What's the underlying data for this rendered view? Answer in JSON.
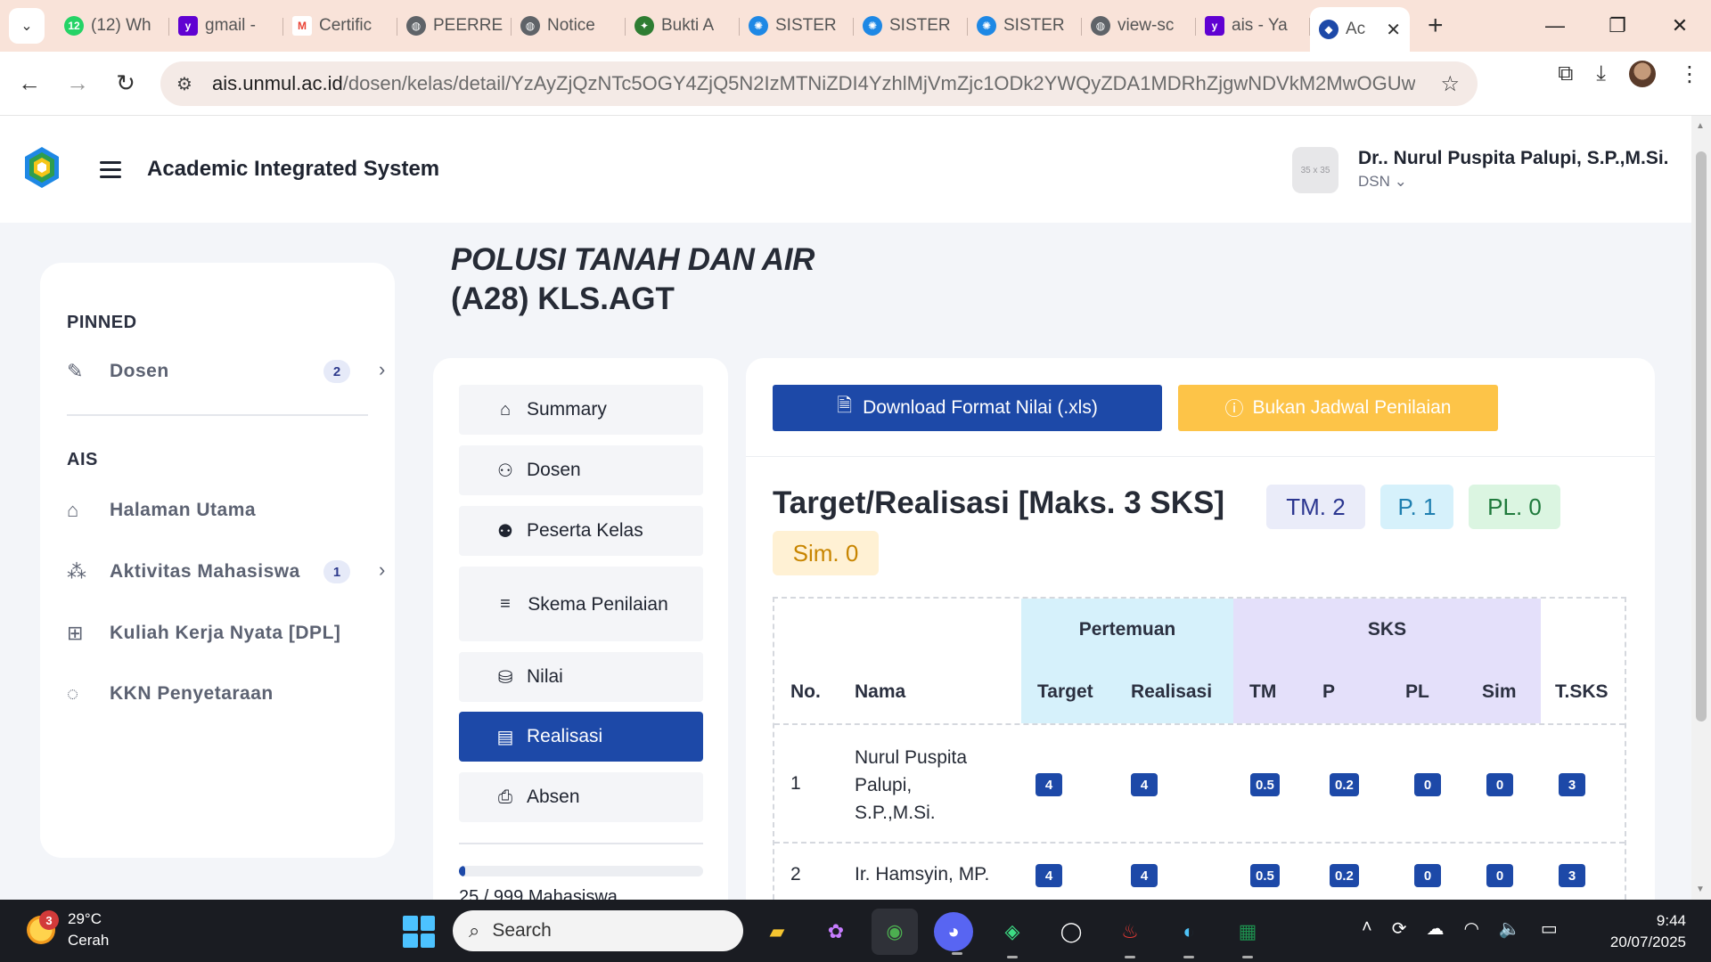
{
  "browser": {
    "tabs": [
      {
        "label": "(12) Wh",
        "icon": "whatsapp-icon",
        "color": "#25d366",
        "badge": "12"
      },
      {
        "label": "gmail -",
        "icon": "yahoo-icon",
        "color": "#6001d2"
      },
      {
        "label": "Certific",
        "icon": "gmail-icon",
        "color": "#ea4335"
      },
      {
        "label": "PEERRE",
        "icon": "globe-icon",
        "color": "#5f6368"
      },
      {
        "label": "Notice",
        "icon": "globe-icon",
        "color": "#5f6368"
      },
      {
        "label": "Bukti A",
        "icon": "unmul-icon",
        "color": "#2e7d32"
      },
      {
        "label": "SISTER",
        "icon": "sister-icon",
        "color": "#1e88e5"
      },
      {
        "label": "SISTER",
        "icon": "sister-icon",
        "color": "#1e88e5"
      },
      {
        "label": "SISTER",
        "icon": "sister-icon",
        "color": "#1e88e5"
      },
      {
        "label": "view-sc",
        "icon": "globe-icon",
        "color": "#5f6368"
      },
      {
        "label": "ais - Ya",
        "icon": "yahoo-icon",
        "color": "#6001d2"
      }
    ],
    "active_tab": {
      "label": "Ac",
      "icon": "ais-logo-icon"
    },
    "url_host": "ais.unmul.ac.id",
    "url_path": "/dosen/kelas/detail/YzAyZjQzNTc5OGY4ZjQ5N2IzMTNiZDI4YzhlMjVmZjc1ODk2YWQyZDA1MDRhZjgwNDVkM2MwOGUwMzEwO..."
  },
  "header": {
    "app_title": "Academic Integrated System",
    "avatar_placeholder": "35 x 35",
    "user_name": "Dr.. Nurul Puspita Palupi, S.P.,M.Si.",
    "user_role": "DSN"
  },
  "sidebar": {
    "pinned_title": "PINNED",
    "pinned_items": [
      {
        "label": "Dosen",
        "badge": "2"
      }
    ],
    "ais_title": "AIS",
    "ais_items": [
      {
        "label": "Halaman Utama"
      },
      {
        "label": "Aktivitas Mahasiswa",
        "badge": "1"
      },
      {
        "label": "Kuliah Kerja Nyata [DPL]"
      },
      {
        "label": "KKN Penyetaraan"
      }
    ]
  },
  "course": {
    "title": "POLUSI TANAH DAN AIR",
    "code": "(A28) KLS.AGT"
  },
  "class_menu": {
    "items": [
      {
        "label": "Summary",
        "icon": "home-icon"
      },
      {
        "label": "Dosen",
        "icon": "user-plus-icon"
      },
      {
        "label": "Peserta Kelas",
        "icon": "users-icon"
      },
      {
        "label": "Skema Penilaian",
        "icon": "menu-lines-icon"
      },
      {
        "label": "Nilai",
        "icon": "database-icon"
      },
      {
        "label": "Realisasi",
        "icon": "document-icon",
        "active": true
      },
      {
        "label": "Absen",
        "icon": "printer-icon"
      }
    ],
    "progress_label": "25 / 999 Mahasiswa",
    "progress_fraction": 0.025
  },
  "panel": {
    "download_button": "Download Format Nilai (.xls)",
    "schedule_button": "Bukan Jadwal Penilaian",
    "target_title": "Target/Realisasi [Maks. 3 SKS]",
    "chips": {
      "tm": "TM. 2",
      "p": "P. 1",
      "pl": "PL. 0",
      "sim": "Sim. 0"
    },
    "table": {
      "group_headers": {
        "pertemuan": "Pertemuan",
        "sks": "SKS"
      },
      "headers": {
        "no": "No.",
        "nama": "Nama",
        "target": "Target",
        "realisasi": "Realisasi",
        "tm": "TM",
        "p": "P",
        "pl": "PL",
        "sim": "Sim",
        "tsks": "T.SKS"
      },
      "rows": [
        {
          "no": "1",
          "nama": "Nurul Puspita Palupi, S.P.,M.Si.",
          "target": "4",
          "realisasi": "4",
          "tm": "0.5",
          "p": "0.2",
          "pl": "0",
          "sim": "0",
          "tsks": "3"
        },
        {
          "no": "2",
          "nama": "Ir. Hamsyin, MP.",
          "target": "4",
          "realisasi": "4",
          "tm": "0.5",
          "p": "0.2",
          "pl": "0",
          "sim": "0",
          "tsks": "3"
        }
      ]
    }
  },
  "taskbar": {
    "weather_badge": "3",
    "temperature": "29°C",
    "condition": "Cerah",
    "search_placeholder": "Search",
    "time": "9:44",
    "date": "20/07/2025"
  },
  "colors": {
    "primary": "#1d49a8",
    "warning": "#fdc448",
    "tab_strip": "#f9e3d9"
  }
}
